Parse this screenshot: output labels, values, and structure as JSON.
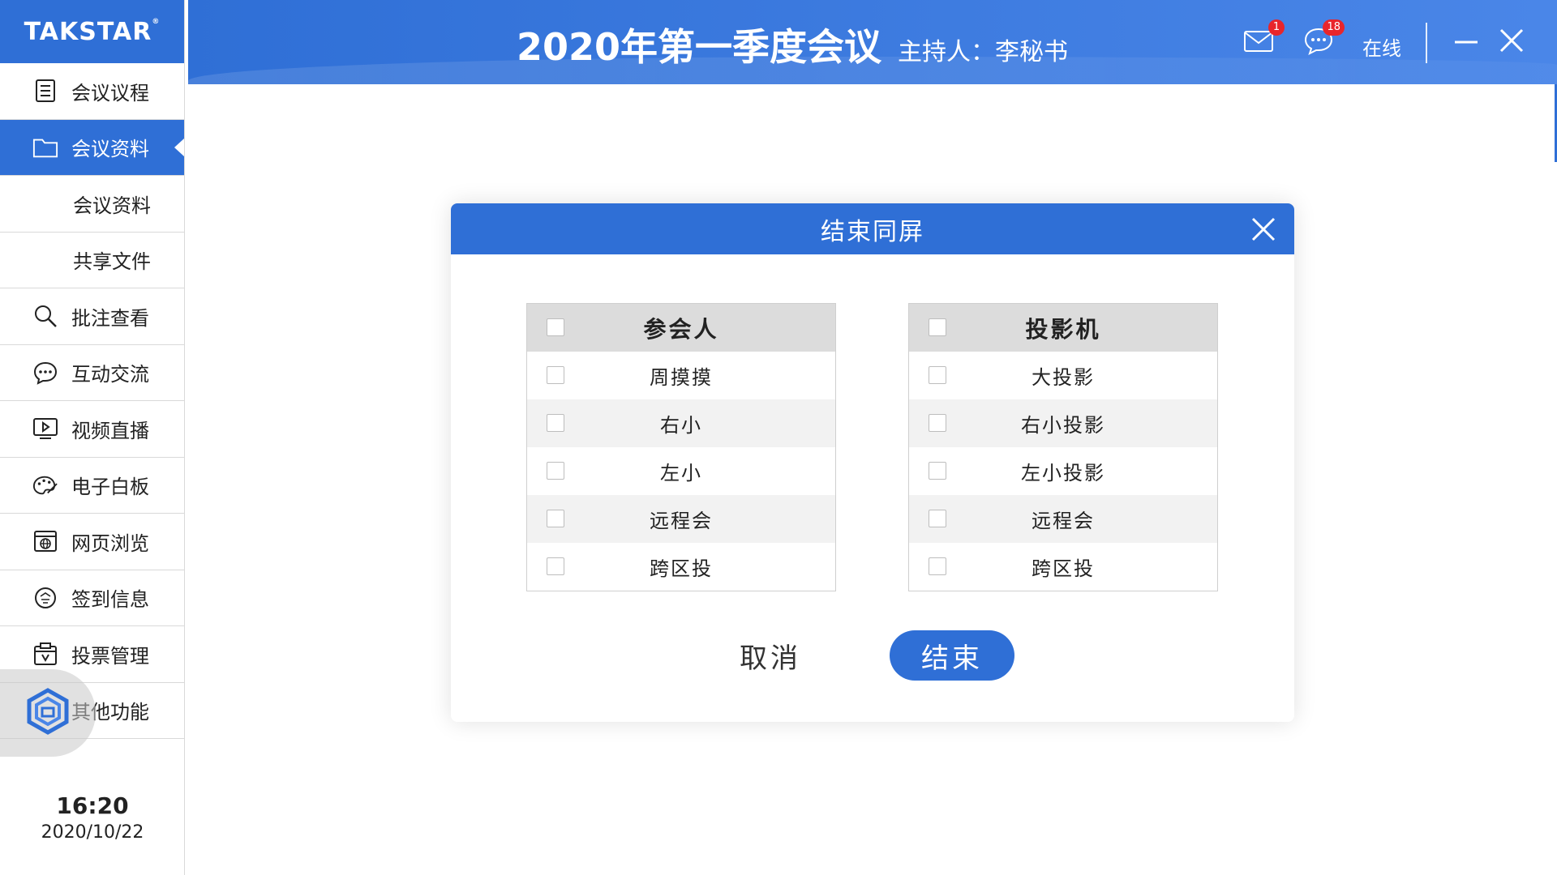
{
  "brand": {
    "logo_text": "TAKSTAR",
    "logo_mark": "®"
  },
  "colors": {
    "primary": "#2f6fd6",
    "badge": "#e8252b",
    "row_alt": "#f2f2f2",
    "panel_head": "#dcdcdc"
  },
  "sidebar": {
    "items": [
      {
        "label": "会议议程",
        "icon": "document-list-icon",
        "active": false,
        "sub": false
      },
      {
        "label": "会议资料",
        "icon": "folder-icon",
        "active": true,
        "sub": false
      },
      {
        "label": "会议资料",
        "icon": "",
        "active": false,
        "sub": true
      },
      {
        "label": "共享文件",
        "icon": "",
        "active": false,
        "sub": true
      },
      {
        "label": "批注查看",
        "icon": "search-icon",
        "active": false,
        "sub": false
      },
      {
        "label": "互动交流",
        "icon": "chat-bubble-icon",
        "active": false,
        "sub": false
      },
      {
        "label": "视频直播",
        "icon": "video-play-icon",
        "active": false,
        "sub": false
      },
      {
        "label": "电子白板",
        "icon": "palette-icon",
        "active": false,
        "sub": false
      },
      {
        "label": "网页浏览",
        "icon": "browser-globe-icon",
        "active": false,
        "sub": false
      },
      {
        "label": "签到信息",
        "icon": "sign-in-icon",
        "active": false,
        "sub": false
      },
      {
        "label": "投票管理",
        "icon": "ballot-box-icon",
        "active": false,
        "sub": false
      },
      {
        "label": "其他功能",
        "icon": "grid-icon",
        "active": false,
        "sub": false
      }
    ],
    "floating_button_icon": "hexagon-app-icon",
    "clock": {
      "time": "16:20",
      "date": "2020/10/22"
    }
  },
  "header": {
    "title": "2020年第一季度会议",
    "host_label": "主持人：",
    "host_name": "李秘书",
    "mail_icon": "mail-icon",
    "mail_badge": "1",
    "chat_icon": "chat-icon",
    "chat_badge": "18",
    "status": "在线",
    "minimize_icon": "minimize-icon",
    "close_icon": "close-icon"
  },
  "dialog": {
    "title": "结束同屏",
    "close_icon": "close-icon",
    "participants": {
      "header": "参会人",
      "rows": [
        "周摸摸",
        "右小",
        "左小",
        "远程会",
        "跨区投"
      ]
    },
    "projectors": {
      "header": "投影机",
      "rows": [
        "大投影",
        "右小投影",
        "左小投影",
        "远程会",
        "跨区投"
      ]
    },
    "cancel_label": "取消",
    "confirm_label": "结束"
  }
}
